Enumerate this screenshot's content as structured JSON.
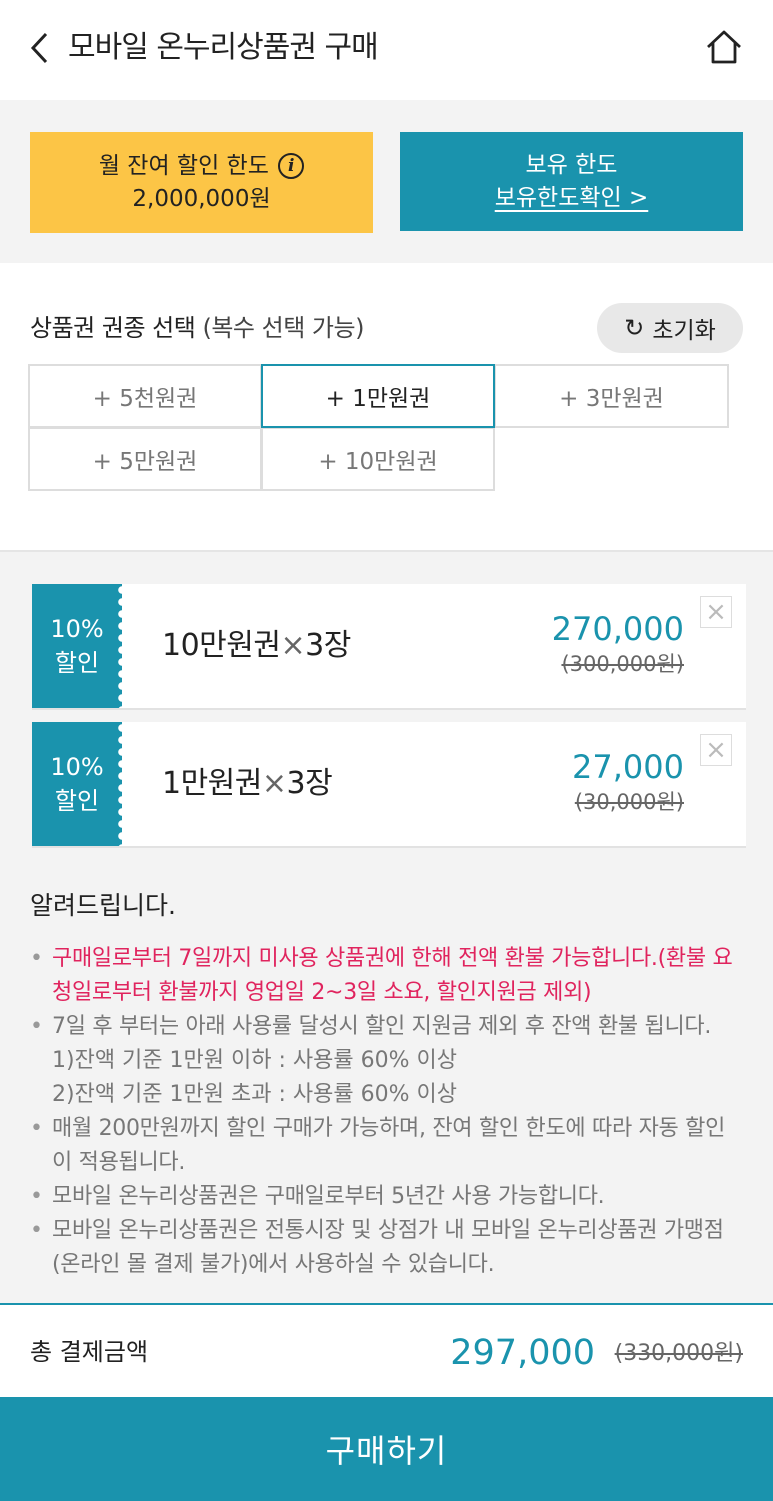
{
  "header": {
    "title": "모바일 온누리상품권 구매"
  },
  "limits": {
    "monthly_label": "월 잔여 할인 한도",
    "monthly_value": "2,000,000원",
    "own_label": "보유 한도",
    "own_link": "보유한도확인 >"
  },
  "selection": {
    "title": "상품권 권종 선택",
    "subtitle": "(복수 선택 가능)",
    "reset_label": "초기화",
    "options": [
      {
        "label": "+ 5천원권",
        "selected": false
      },
      {
        "label": "+ 1만원권",
        "selected": true
      },
      {
        "label": "+ 3만원권",
        "selected": false
      },
      {
        "label": "+ 5만원권",
        "selected": false
      },
      {
        "label": "+ 10만원권",
        "selected": false
      }
    ]
  },
  "cart": [
    {
      "discount": "10%",
      "discount_label": "할인",
      "name": "10만원권",
      "times": "×",
      "qty": "3장",
      "price": "270,000",
      "original": "(300,000원)"
    },
    {
      "discount": "10%",
      "discount_label": "할인",
      "name": "1만원권",
      "times": "×",
      "qty": "3장",
      "price": "27,000",
      "original": "(30,000원)"
    }
  ],
  "notice": {
    "title": "알려드립니다.",
    "red_item": "구매일로부터 7일까지 미사용 상품권에 한해 전액 환불 가능합니다.(환불 요청일로부터 환불까지 영업일 2~3일 소요, 할인지원금 제외)",
    "item2": "7일 후 부터는 아래 사용률 달성시 할인 지원금 제외 후 잔액 환불 됩니다.",
    "sub1": "1)잔액 기준 1만원 이하 : 사용률 60% 이상",
    "sub2": "2)잔액 기준 1만원 초과 : 사용률 60% 이상",
    "item3": "매월 200만원까지 할인 구매가 가능하며, 잔여 할인 한도에 따라 자동 할인이 적용됩니다.",
    "item4": "모바일 온누리상품권은 구매일로부터 5년간 사용 가능합니다.",
    "item5": "모바일 온누리상품권은 전통시장 및 상점가 내 모바일 온누리상품권 가맹점(온라인 몰 결제 불가)에서 사용하실 수 있습니다."
  },
  "total": {
    "label": "총 결제금액",
    "price": "297,000",
    "original": "(330,000원)"
  },
  "buy_label": "구매하기",
  "colors": {
    "accent": "#1a93ad",
    "yellow": "#fcc546",
    "red": "#e0245e"
  }
}
